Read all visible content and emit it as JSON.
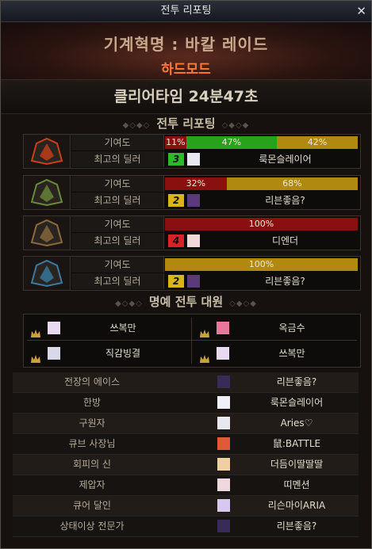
{
  "window": {
    "title": "전투 리포팅",
    "close_glyph": "✕"
  },
  "header": {
    "raid_name": "기계혁명 : 바칼 레이드",
    "mode": "하드모드"
  },
  "clear_time": "클리어타임  24분47초",
  "section_report": "전투 리포팅",
  "section_honor": "명예 전투 대원",
  "contribution_label": "기여도",
  "top_dealer_label": "최고의 딜러",
  "parties": [
    {
      "segments": [
        {
          "pct": "11%",
          "w": 11,
          "color": "red"
        },
        {
          "pct": "47%",
          "w": 47,
          "color": "green"
        },
        {
          "pct": "42%",
          "w": 42,
          "color": "gold"
        }
      ],
      "rank": "3",
      "rank_color": "#2fb82a",
      "dealer": "룩몬슬레이어"
    },
    {
      "segments": [
        {
          "pct": "32%",
          "w": 32,
          "color": "red"
        },
        {
          "pct": "68%",
          "w": 68,
          "color": "gold"
        }
      ],
      "rank": "2",
      "rank_color": "#d9b51a",
      "dealer": "리븐좋음?"
    },
    {
      "segments": [
        {
          "pct": "100%",
          "w": 100,
          "color": "red"
        }
      ],
      "rank": "4",
      "rank_color": "#d8222a",
      "dealer": "디엔더"
    },
    {
      "segments": [
        {
          "pct": "100%",
          "w": 100,
          "color": "gold"
        }
      ],
      "rank": "2",
      "rank_color": "#d9b51a",
      "dealer": "리븐좋음?"
    }
  ],
  "honor": [
    "쓰복만",
    "옥금수",
    "직감빙결",
    "쓰복만"
  ],
  "awards": [
    {
      "title": "전장의 에이스",
      "name": "리븐좋음?"
    },
    {
      "title": "한방",
      "name": "룩몬슬레이어"
    },
    {
      "title": "구원자",
      "name": "Aries♡"
    },
    {
      "title": "큐브 사장님",
      "name": "鼠:BATTLE"
    },
    {
      "title": "회피의 신",
      "name": "더듬이딸딸딸"
    },
    {
      "title": "제압자",
      "name": "띠멘션"
    },
    {
      "title": "큐어 달인",
      "name": "리슨마이ARIA"
    },
    {
      "title": "상태이상 전문가",
      "name": "리븐좋음?"
    }
  ],
  "colors": {
    "red": "#8a1010",
    "green": "#28a21a",
    "gold": "#b08a10",
    "mode": "#ff7b3a"
  }
}
